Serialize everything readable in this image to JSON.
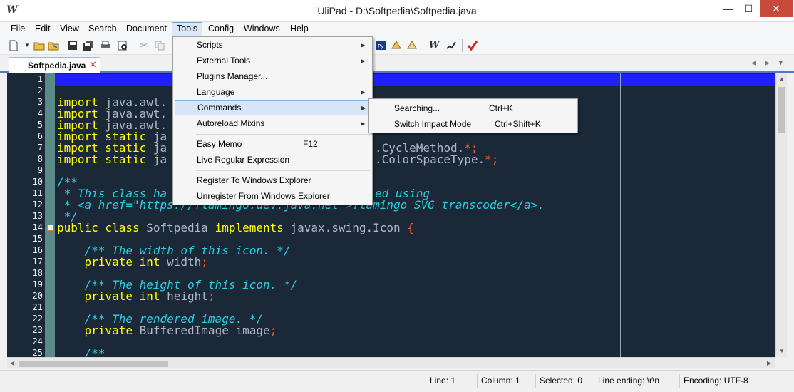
{
  "window": {
    "title": "UliPad - D:\\Softpedia\\Softpedia.java",
    "app_icon": "W",
    "minimize": "—",
    "maximize": "☐",
    "close": "✕"
  },
  "menubar": [
    "File",
    "Edit",
    "View",
    "Search",
    "Document",
    "Tools",
    "Config",
    "Windows",
    "Help"
  ],
  "tabs": [
    {
      "label": "Softpedia.java",
      "close": "✕"
    }
  ],
  "tab_nav": {
    "prev": "◀",
    "next": "▶",
    "list": "▼"
  },
  "editor": {
    "line_numbers": [
      "1",
      "2",
      "3",
      "4",
      "5",
      "6",
      "7",
      "8",
      "9",
      "10",
      "11",
      "12",
      "13",
      "14",
      "15",
      "16",
      "17",
      "18",
      "19",
      "20",
      "21",
      "22",
      "23",
      "24",
      "25"
    ],
    "lines": {
      "l3": {
        "kw": "import",
        "rest": " java.awt."
      },
      "l4": {
        "kw": "import",
        "rest": " java.awt."
      },
      "l5": {
        "kw": "import",
        "rest": " java.awt."
      },
      "l6": {
        "kw": "import static",
        "rest": " ja"
      },
      "l7": {
        "kw": "import static",
        "rest": " ja",
        "tail": ".CycleMethod.",
        "star": "*",
        "semi": ";"
      },
      "l8": {
        "kw": "import static",
        "rest": " ja",
        "tail": ".ColorSpaceType.",
        "star": "*",
        "semi": ";"
      },
      "l10": "/**",
      "l11_a": " * This class ha",
      "l11_b": "ed using",
      "l12_a": " * <a href=\"https://flamingo.dev.java.net\">flamingo SVG transcoder</a>.",
      "l13": " */",
      "l14": {
        "kw1": "public class",
        "name": " Softpedia ",
        "kw2": "implements",
        "rest": " javax.swing.Icon ",
        "brace": "{"
      },
      "l16": "    /** The width of this icon. */",
      "l17": {
        "kw": "    private int",
        "rest": " width",
        "semi": ";"
      },
      "l19": "    /** The height of this icon. */",
      "l20": {
        "kw": "    private int",
        "rest": " height",
        "semi": ";"
      },
      "l22": "    /** The rendered image. */",
      "l23": {
        "kw": "    private",
        "rest": " BufferedImage image",
        "semi": ";"
      },
      "l25": "    /**"
    }
  },
  "tools_menu": {
    "items": [
      {
        "label": "Scripts",
        "submenu": true
      },
      {
        "label": "External Tools",
        "submenu": true
      },
      {
        "label": "Plugins Manager..."
      },
      {
        "label": "Language",
        "submenu": true
      },
      {
        "label": "Commands",
        "submenu": true
      },
      {
        "label": "Autoreload Mixins",
        "submenu": true
      },
      {
        "label": "Easy Memo",
        "shortcut": "F12"
      },
      {
        "label": "Live Regular Expression"
      },
      {
        "label": "Register To Windows Explorer"
      },
      {
        "label": "Unregister From Windows Explorer"
      }
    ],
    "arrow": "▶"
  },
  "commands_submenu": {
    "items": [
      {
        "label": "Searching...",
        "shortcut": "Ctrl+K"
      },
      {
        "label": "Switch Impact Mode",
        "shortcut": "Ctrl+Shift+K"
      }
    ]
  },
  "status": {
    "line": "Line: 1",
    "column": "Column: 1",
    "selected": "Selected: 0",
    "line_ending": "Line ending: \\r\\n",
    "encoding": "Encoding: UTF-8"
  },
  "colors": {
    "editor_bg": "#1b2838",
    "keyword": "#ffff00",
    "comment": "#2ad0e0",
    "operator": "#ff5a2a",
    "current_line": "#2020ff",
    "close_button": "#c74a3a"
  }
}
